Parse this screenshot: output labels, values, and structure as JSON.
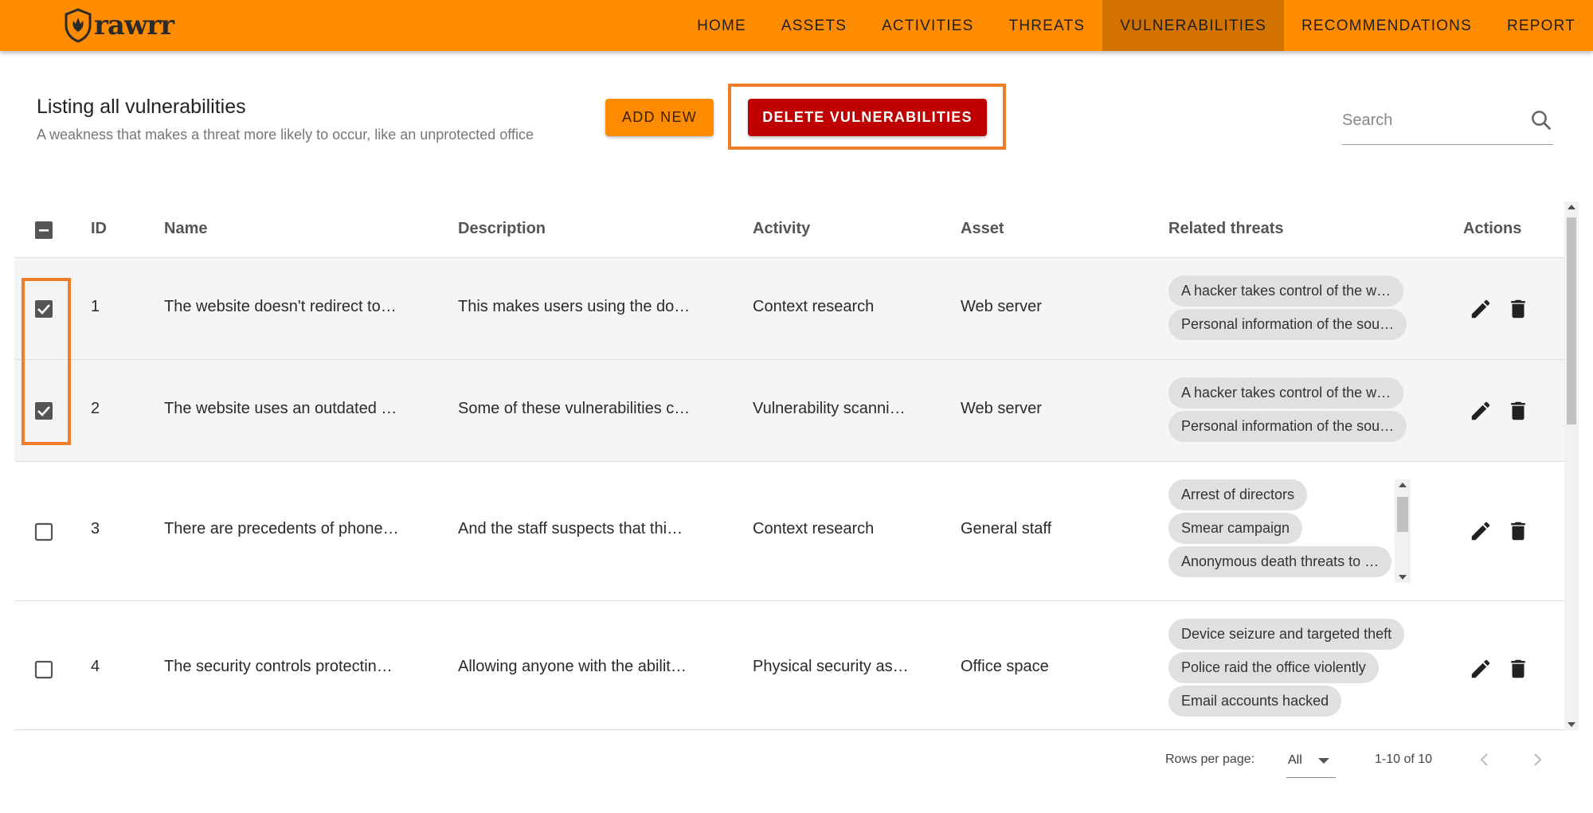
{
  "nav": {
    "logo_text": "rawrr",
    "items": [
      {
        "label": "HOME"
      },
      {
        "label": "ASSETS"
      },
      {
        "label": "ACTIVITIES"
      },
      {
        "label": "THREATS"
      },
      {
        "label": "VULNERABILITIES",
        "active": true
      },
      {
        "label": "RECOMMENDATIONS"
      },
      {
        "label": "REPORT"
      }
    ]
  },
  "header": {
    "title": "Listing all vulnerabilities",
    "subtitle": "A weakness that makes a threat more likely to occur, like an unprotected office",
    "add_label": "ADD NEW",
    "delete_label": "DELETE VULNERABILITIES",
    "search_placeholder": "Search"
  },
  "table": {
    "columns": [
      "ID",
      "Name",
      "Description",
      "Activity",
      "Asset",
      "Related threats",
      "Actions"
    ],
    "rows": [
      {
        "id": "1",
        "checked": true,
        "name": "The website doesn't redirect to…",
        "description": "This makes users using the do…",
        "activity": "Context research",
        "asset": "Web server",
        "threats": [
          "A hacker takes control of the w…",
          "Personal information of the sou…"
        ]
      },
      {
        "id": "2",
        "checked": true,
        "name": "The website uses an outdated …",
        "description": "Some of these vulnerabilities c…",
        "activity": "Vulnerability scanni…",
        "asset": "Web server",
        "threats": [
          "A hacker takes control of the w…",
          "Personal information of the sou…"
        ]
      },
      {
        "id": "3",
        "checked": false,
        "name": "There are precedents of phone…",
        "description": "And the staff suspects that thi…",
        "activity": "Context research",
        "asset": "General staff",
        "threats": [
          "Arrest of directors",
          "Smear campaign",
          "Anonymous death threats to …"
        ]
      },
      {
        "id": "4",
        "checked": false,
        "name": "The security controls protectin…",
        "description": "Allowing anyone with the abilit…",
        "activity": "Physical security as…",
        "asset": "Office space",
        "threats": [
          "Device seizure and targeted theft",
          "Police raid the office violently",
          "Email accounts hacked"
        ]
      }
    ]
  },
  "footer": {
    "rows_per_page_label": "Rows per page:",
    "rows_per_page_value": "All",
    "range": "1-10 of 10"
  },
  "colors": {
    "brand": "#FF8C00",
    "nav_active": "#D27300",
    "danger": "#C00000",
    "highlight": "#F07D2A"
  }
}
